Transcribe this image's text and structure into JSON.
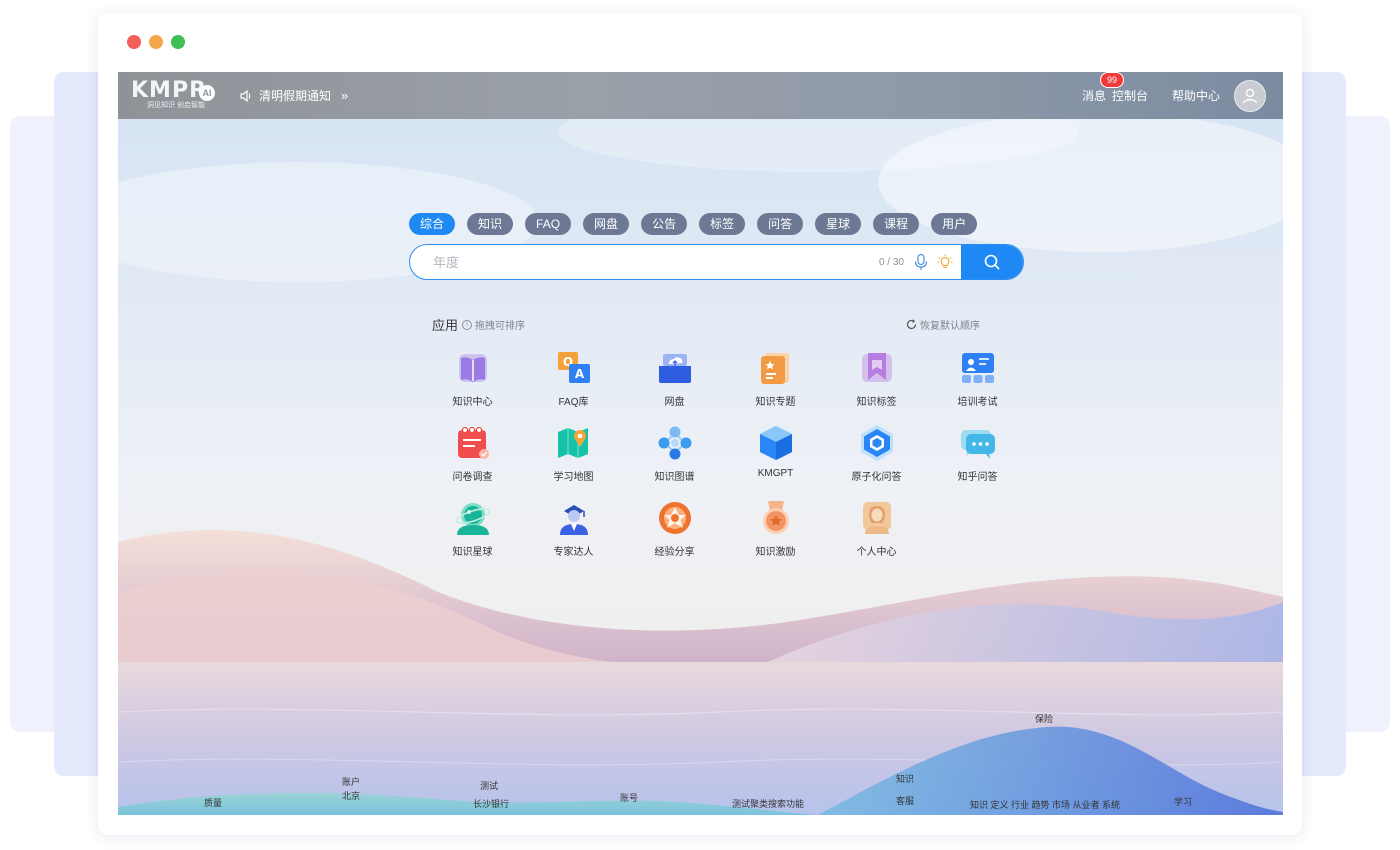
{
  "header": {
    "logo_text": "KMPR",
    "logo_badge": "AI",
    "logo_slogan": "洞见知识 创启智能",
    "notice": "清明假期通知",
    "notice_more": "»",
    "nav": {
      "messages": "消息",
      "messages_count": "99",
      "console": "控制台",
      "help": "帮助中心"
    }
  },
  "search": {
    "tabs": [
      "综合",
      "知识",
      "FAQ",
      "网盘",
      "公告",
      "标签",
      "问答",
      "星球",
      "课程",
      "用户"
    ],
    "active_tab": "综合",
    "placeholder": "年度",
    "counter": "0 / 30"
  },
  "apps": {
    "title": "应用",
    "hint": "拖拽可排序",
    "reset": "恢复默认顺序",
    "items": [
      {
        "label": "知识中心",
        "icon": "book-icon",
        "color": "#9b7ae6"
      },
      {
        "label": "FAQ库",
        "icon": "qa-icon",
        "color": "#2f7ff5"
      },
      {
        "label": "网盘",
        "icon": "cloud-drive-icon",
        "color": "#2f5de0"
      },
      {
        "label": "知识专题",
        "icon": "topic-icon",
        "color": "#f39a45"
      },
      {
        "label": "知识标签",
        "icon": "bookmark-icon",
        "color": "#b67de0"
      },
      {
        "label": "培训考试",
        "icon": "training-icon",
        "color": "#2f7ff5"
      },
      {
        "label": "问卷调查",
        "icon": "survey-icon",
        "color": "#f04d4d"
      },
      {
        "label": "学习地图",
        "icon": "map-icon",
        "color": "#16c2a8"
      },
      {
        "label": "知识图谱",
        "icon": "graph-icon",
        "color": "#3a9bf0"
      },
      {
        "label": "KMGPT",
        "icon": "cube-icon",
        "color": "#2a86f5"
      },
      {
        "label": "原子化问答",
        "icon": "hexagon-icon",
        "color": "#2a86f5"
      },
      {
        "label": "知乎问答",
        "icon": "chat-icon",
        "color": "#43b8e8"
      },
      {
        "label": "知识星球",
        "icon": "planet-icon",
        "color": "#18b59a"
      },
      {
        "label": "专家达人",
        "icon": "expert-icon",
        "color": "#3b62e5"
      },
      {
        "label": "经验分享",
        "icon": "share-icon",
        "color": "#f0722f"
      },
      {
        "label": "知识激励",
        "icon": "medal-icon",
        "color": "#f29466"
      },
      {
        "label": "个人中心",
        "icon": "person-icon",
        "color": "#e4a06a"
      }
    ]
  },
  "word_cloud": [
    "质量",
    "账户",
    "北京",
    "测试",
    "长沙银行",
    "账号",
    "测试聚类搜索功能",
    "知识",
    "客服",
    "保险",
    "知识 定义 行业 趋势 市场 从业者 系统",
    "学习"
  ],
  "colors": {
    "accent": "#1e88f5",
    "tab": "#6d7895",
    "badge": "#f23a3a"
  }
}
